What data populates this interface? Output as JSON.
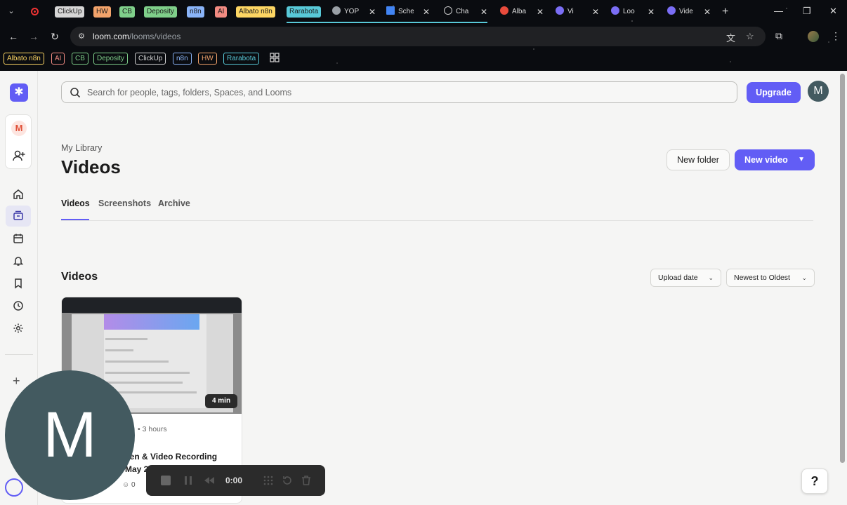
{
  "browser": {
    "tab_groups": [
      {
        "label": "ClickUp",
        "color": "#d6d6d6"
      },
      {
        "label": "HW",
        "color": "#f2a36b"
      },
      {
        "label": "CB",
        "color": "#7fcf8a"
      },
      {
        "label": "Deposity",
        "color": "#7fcf8a"
      },
      {
        "label": "n8n",
        "color": "#8ab4f8"
      },
      {
        "label": "AI",
        "color": "#f28b82"
      },
      {
        "label": "Albato n8n",
        "color": "#fdd663"
      },
      {
        "label": "Rarabota",
        "color": "#58c9d8"
      }
    ],
    "tabs": [
      {
        "label": "YOP",
        "icon": "yop-favicon-icon"
      },
      {
        "label": "Sche",
        "icon": "chart-favicon-icon"
      },
      {
        "label": "Cha",
        "icon": "chat-favicon-icon"
      },
      {
        "label": "Alba",
        "icon": "albato-favicon-icon"
      },
      {
        "label": "Vi",
        "icon": "loom-favicon-icon"
      },
      {
        "label": "Loo",
        "icon": "loom-favicon-icon"
      },
      {
        "label": "Vide",
        "icon": "loom-favicon-icon"
      }
    ],
    "url_host": "loom.com",
    "url_path": "/looms/videos",
    "bookmarks": [
      {
        "label": "Albato n8n",
        "color": "#fdd663"
      },
      {
        "label": "AI",
        "color": "#f28b82"
      },
      {
        "label": "CB",
        "color": "#7fcf8a"
      },
      {
        "label": "Deposity",
        "color": "#7fcf8a"
      },
      {
        "label": "ClickUp",
        "color": "#d6d6d6"
      },
      {
        "label": "n8n",
        "color": "#8ab4f8"
      },
      {
        "label": "HW",
        "color": "#f2a36b"
      },
      {
        "label": "Rarabota",
        "color": "#58c9d8"
      }
    ]
  },
  "loom": {
    "accent": "#625df5",
    "workspace_initial": "M",
    "search_placeholder": "Search for people, tags, folders, Spaces, and Looms",
    "upgrade_label": "Upgrade",
    "user_initial": "M",
    "breadcrumb": "My Library",
    "title": "Videos",
    "new_folder_label": "New folder",
    "new_video_label": "New video",
    "tabs": [
      "Videos",
      "Screenshots",
      "Archive"
    ],
    "section_title": "Videos",
    "sort_field": "Upload date",
    "sort_order": "Newest to Oldest",
    "video": {
      "duration": "4 min",
      "meta": "• 3 hours",
      "title_line1": "een & Video Recording",
      "title_line2": "May 2025",
      "comments": "0"
    },
    "help_label": "?",
    "recorder_timer": "0:00",
    "camera_initial": "M"
  }
}
